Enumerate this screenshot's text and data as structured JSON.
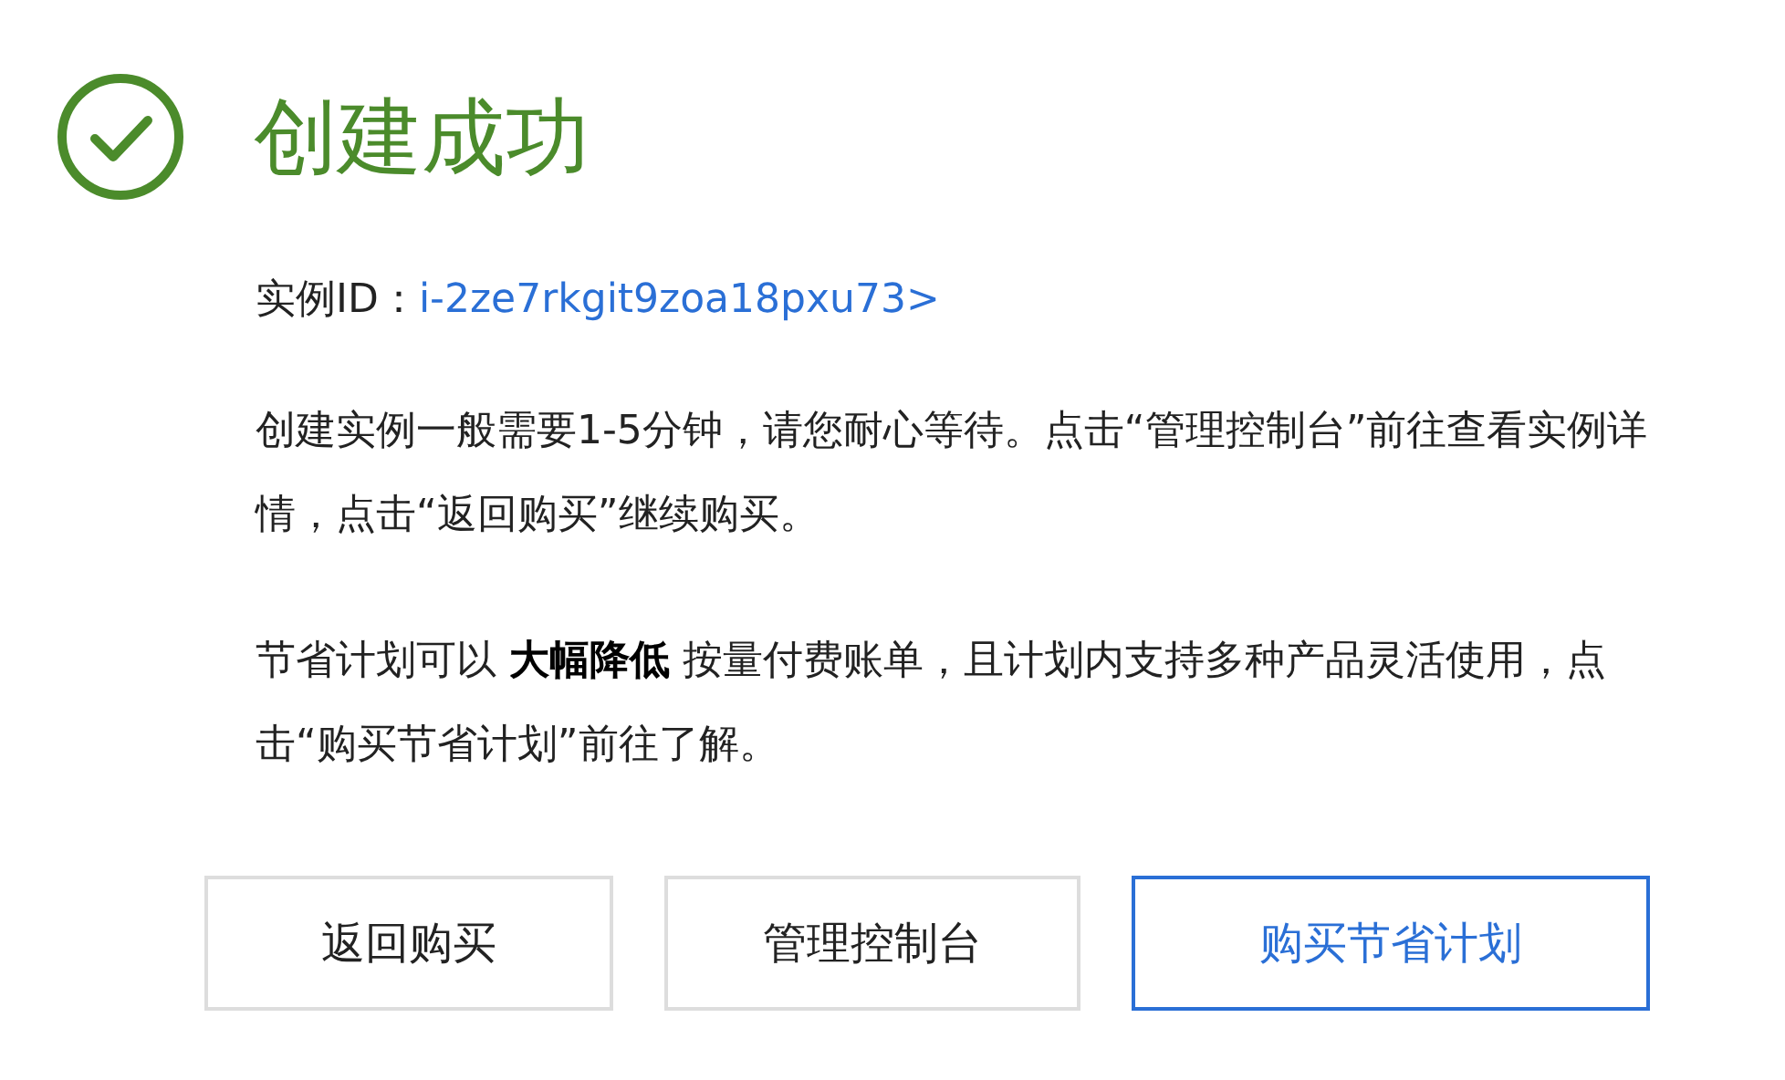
{
  "title": "创建成功",
  "instance_id": {
    "label": "实例ID：",
    "value": "i-2ze7rkgit9zoa18pxu73>"
  },
  "paragraphs": [
    "创建实例一般需要1-5分钟，请您耐心等待。点击“管理控制台”前往查看实例详情，点击“返回购买”继续购买。",
    "节省计划可以 **大幅降低** 按量付费账单，且计划内支持多种产品灵活使用，点击“购买节省计划”前往了解。"
  ],
  "buttons": [
    {
      "label": "返回购买",
      "kind": "default"
    },
    {
      "label": "管理控制台",
      "kind": "default"
    },
    {
      "label": "购买节省计划",
      "kind": "primary"
    }
  ]
}
